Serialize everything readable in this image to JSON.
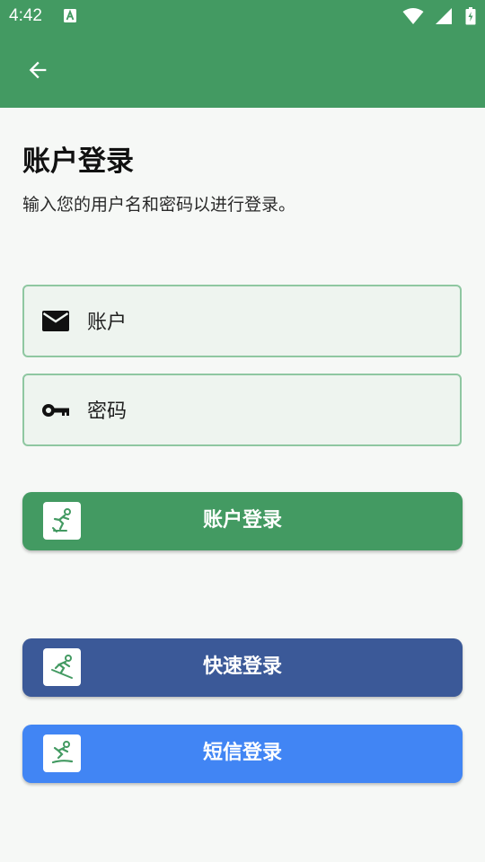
{
  "status_bar": {
    "time": "4:42",
    "notification_icon": "font-a-icon",
    "icons": [
      "wifi-icon",
      "signal-icon",
      "battery-icon"
    ]
  },
  "toolbar": {
    "back_icon": "arrow-left-icon"
  },
  "page": {
    "title": "账户登录",
    "subtitle": "输入您的用户名和密码以进行登录。"
  },
  "form": {
    "account": {
      "placeholder": "账户",
      "value": "",
      "icon": "email-icon"
    },
    "password": {
      "placeholder": "密码",
      "value": "",
      "icon": "key-icon"
    }
  },
  "buttons": {
    "account_login": {
      "label": "账户登录",
      "color": "#439a62",
      "icon": "skater-icon"
    },
    "quick_login": {
      "label": "快速登录",
      "color": "#3b5998",
      "icon": "skier-icon"
    },
    "sms_login": {
      "label": "短信登录",
      "color": "#4185f4",
      "icon": "snowboarder-icon"
    }
  },
  "colors": {
    "primary": "#439a62",
    "field_border": "#8fc7a1",
    "field_bg": "#eef4ef",
    "background": "#f6f8f6"
  }
}
